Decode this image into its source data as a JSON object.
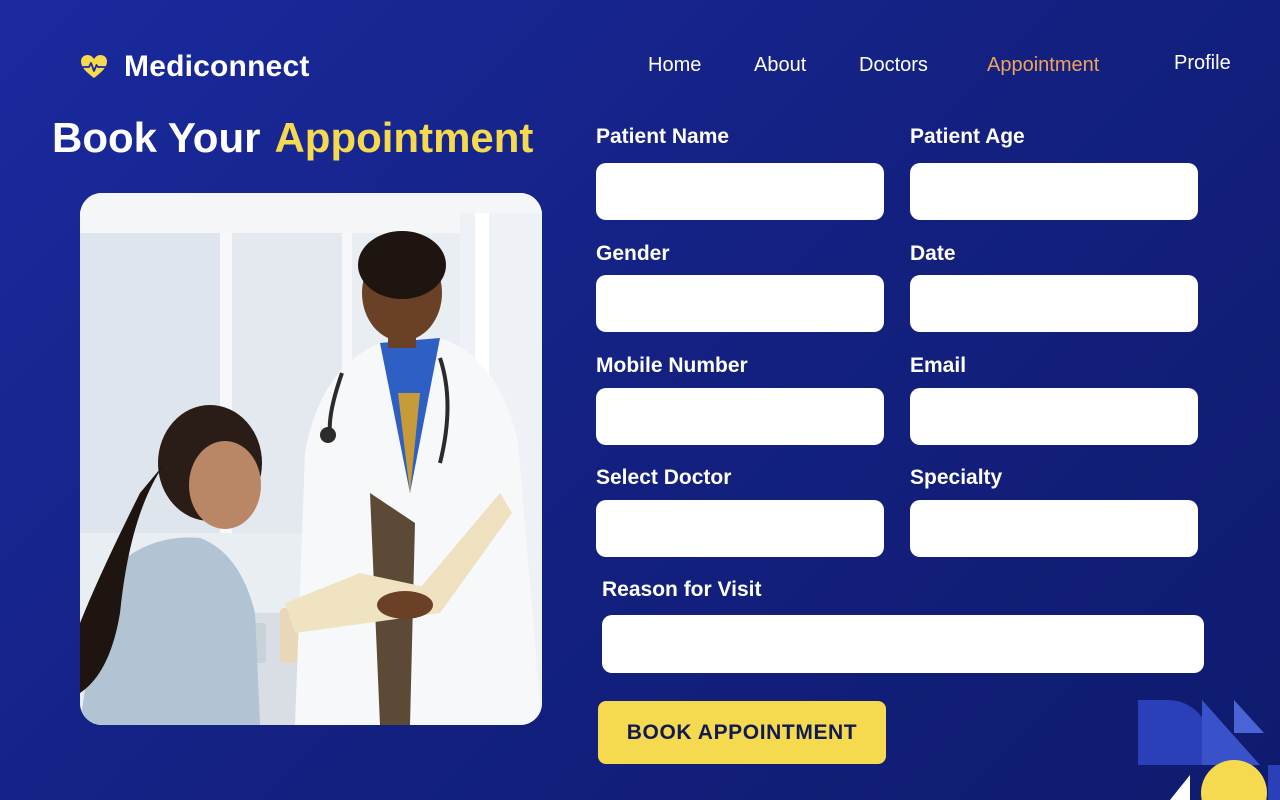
{
  "brand": {
    "name": "Mediconnect",
    "icon": "heart-pulse-icon",
    "icon_color": "#f5d94e"
  },
  "nav": {
    "items": [
      {
        "label": "Home",
        "active": false
      },
      {
        "label": "About",
        "active": false
      },
      {
        "label": "Doctors",
        "active": false
      },
      {
        "label": "Appointment",
        "active": true
      },
      {
        "label": "Profile",
        "active": false
      }
    ]
  },
  "title": {
    "prefix": "Book Your",
    "highlight": "Appointment"
  },
  "form": {
    "fields": {
      "patient_name": {
        "label": "Patient Name",
        "value": ""
      },
      "patient_age": {
        "label": "Patient Age",
        "value": ""
      },
      "gender": {
        "label": "Gender",
        "value": ""
      },
      "date": {
        "label": "Date",
        "value": ""
      },
      "mobile": {
        "label": "Mobile Number",
        "value": ""
      },
      "email": {
        "label": "Email",
        "value": ""
      },
      "doctor": {
        "label": "Select Doctor",
        "value": ""
      },
      "specialty": {
        "label": "Specialty",
        "value": ""
      },
      "reason": {
        "label": "Reason for Visit",
        "value": ""
      }
    },
    "submit_label": "BOOK APPOINTMENT"
  },
  "colors": {
    "background": "#13207f",
    "accent_yellow": "#f5d94e",
    "nav_active": "#f0a35a",
    "input_bg": "#ffffff"
  }
}
